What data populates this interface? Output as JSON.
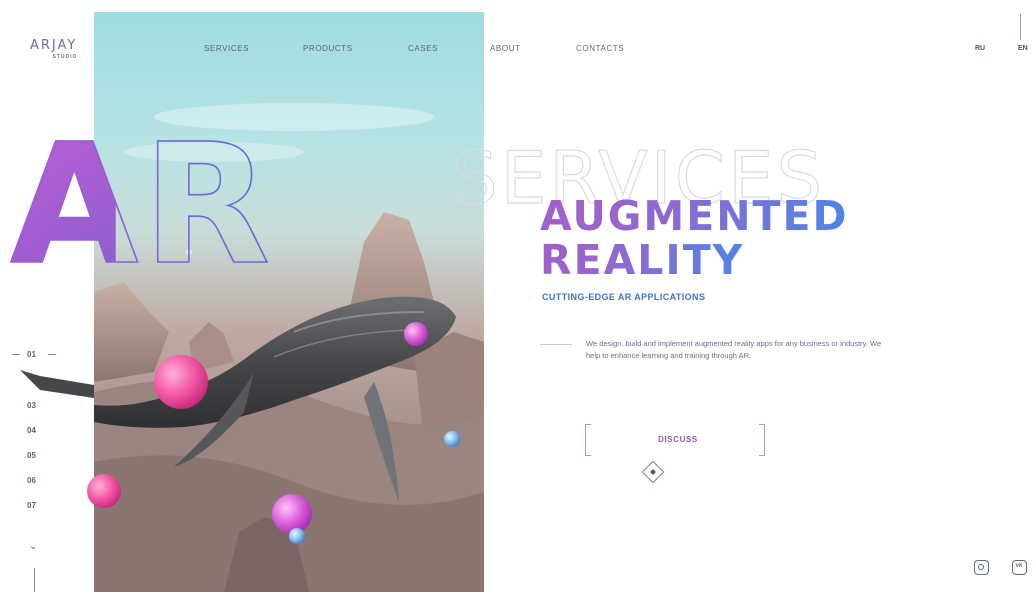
{
  "brand": {
    "name": "ARJAY",
    "subtitle": "STUDIO"
  },
  "nav": {
    "items": [
      "SERVICES",
      "PRODUCTS",
      "CASES",
      "ABOUT",
      "CONTACTS"
    ]
  },
  "languages": {
    "options": [
      "RU",
      "EN"
    ],
    "active": "EN"
  },
  "hero": {
    "outline_word_left": "AR",
    "outline_word_right": "SERVICES",
    "headline_line1": "AUGMENTED",
    "headline_line2": "REALITY",
    "tagline": "CUTTING-EDGE AR APPLICATIONS",
    "description": "We design, build and implement augmented reality apps for any business or industry. We help to enhance learning and training through AR.",
    "cta_label": "DISCUSS"
  },
  "pager": {
    "items": [
      "01",
      "03",
      "04",
      "05",
      "06",
      "07"
    ],
    "current": "01"
  },
  "socials": [
    "instagram-icon",
    "vk-icon"
  ],
  "colors": {
    "accent_purple": "#a260c9",
    "accent_blue": "#4f84e6",
    "outline_purple": "#9b4fc4",
    "text_muted": "#6a6f85"
  }
}
